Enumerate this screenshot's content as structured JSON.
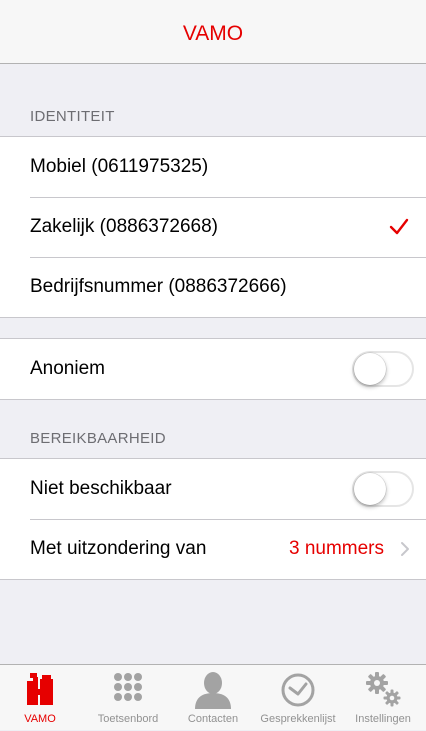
{
  "colors": {
    "accent": "#e60000",
    "inactive": "#929292",
    "background": "#efeff4"
  },
  "nav": {
    "title": "VAMO"
  },
  "identity": {
    "header": "IDENTITEIT",
    "items": [
      {
        "label": "Mobiel (0611975325)",
        "selected": false
      },
      {
        "label": "Zakelijk (0886372668)",
        "selected": true
      },
      {
        "label": "Bedrijfsnummer (0886372666)",
        "selected": false
      }
    ]
  },
  "anonymous": {
    "label": "Anoniem",
    "on": false
  },
  "reachability": {
    "header": "BEREIKBAARHEID",
    "unavailable": {
      "label": "Niet beschikbaar",
      "on": false
    },
    "exception": {
      "label": "Met uitzondering van",
      "value": "3 nummers"
    }
  },
  "tabs": [
    {
      "label": "VAMO",
      "icon": "vamo-icon",
      "active": true
    },
    {
      "label": "Toetsenbord",
      "icon": "keypad-icon",
      "active": false
    },
    {
      "label": "Contacten",
      "icon": "contacts-icon",
      "active": false
    },
    {
      "label": "Gesprekkenlijst",
      "icon": "clock-icon",
      "active": false
    },
    {
      "label": "Instellingen",
      "icon": "gear-icon",
      "active": false
    }
  ]
}
